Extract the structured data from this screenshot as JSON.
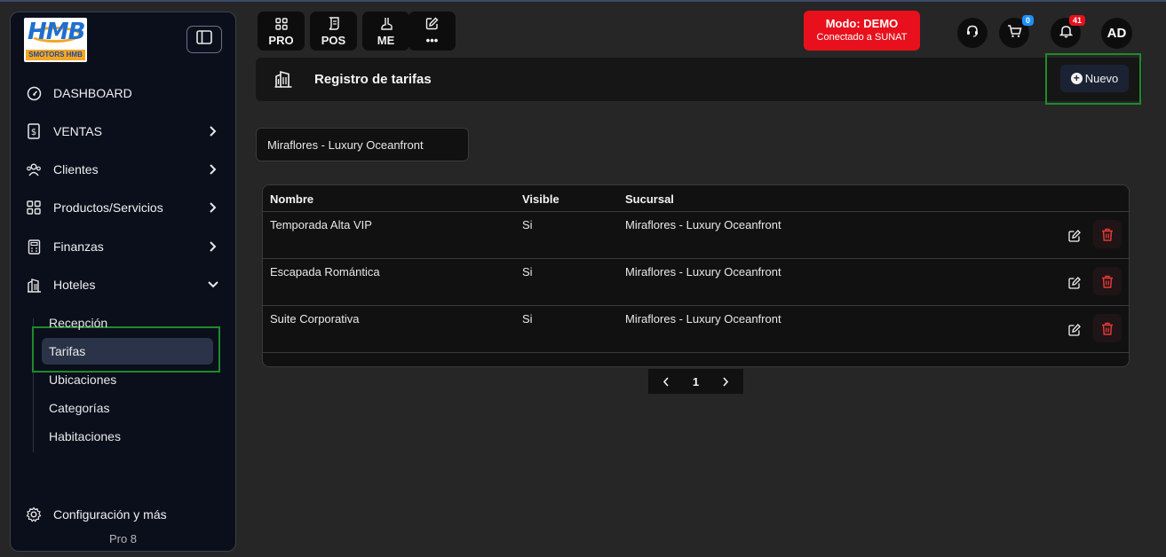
{
  "logo": {
    "big_text": "HMB",
    "small_text": "SMOTORS HMB"
  },
  "sidebar": {
    "items": [
      {
        "label": "DASHBOARD",
        "icon": "gauge-icon",
        "has_chevron": false
      },
      {
        "label": "VENTAS",
        "icon": "receipt-icon",
        "has_chevron": true
      },
      {
        "label": "Clientes",
        "icon": "users-icon",
        "has_chevron": true
      },
      {
        "label": "Productos/Servicios",
        "icon": "grid-icon",
        "has_chevron": true
      },
      {
        "label": "Finanzas",
        "icon": "calculator-icon",
        "has_chevron": true
      },
      {
        "label": "Hoteles",
        "icon": "building-icon",
        "has_chevron": true,
        "expanded": true
      }
    ],
    "subitems": [
      {
        "label": "Recepción"
      },
      {
        "label": "Tarifas",
        "active": true
      },
      {
        "label": "Ubicaciones"
      },
      {
        "label": "Categorías"
      },
      {
        "label": "Habitaciones"
      }
    ],
    "config_label": "Configuración y más",
    "version": "Pro 8"
  },
  "topbar": {
    "quick_buttons": [
      {
        "label": "PRO",
        "icon": "grid-icon"
      },
      {
        "label": "POS",
        "icon": "receipt-icon"
      },
      {
        "label": "ME",
        "icon": "boot-icon"
      },
      {
        "label": "•••",
        "icon": "edit-icon"
      }
    ],
    "demo": {
      "title": "Modo: DEMO",
      "subtitle": "Conectado a SUNAT"
    },
    "cart_badge": "0",
    "notif_badge": "41",
    "avatar": "AD"
  },
  "header": {
    "title": "Registro de tarifas",
    "new_button": "Nuevo"
  },
  "filter": {
    "branch_value": "Miraflores - Luxury Oceanfront"
  },
  "table": {
    "columns": [
      "Nombre",
      "Visible",
      "Sucursal"
    ],
    "rows": [
      {
        "nombre": "Temporada Alta VIP",
        "visible": "Si",
        "sucursal": "Miraflores - Luxury Oceanfront"
      },
      {
        "nombre": "Escapada Romántica",
        "visible": "Si",
        "sucursal": "Miraflores - Luxury Oceanfront"
      },
      {
        "nombre": "Suite Corporativa",
        "visible": "Si",
        "sucursal": "Miraflores - Luxury Oceanfront"
      }
    ]
  },
  "pagination": {
    "current": "1"
  },
  "colors": {
    "demo_red": "#e8101c",
    "highlight_green": "#1e8a2c",
    "delete_red": "#e53935",
    "badge_blue": "#1e90ff"
  }
}
